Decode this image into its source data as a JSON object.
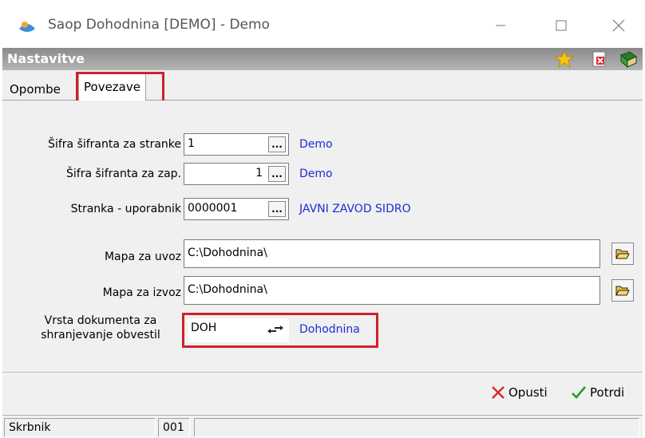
{
  "window": {
    "title": "Saop Dohodnina [DEMO] - Demo",
    "minimize_glyph": "—",
    "maximize_glyph": "☐",
    "close_glyph": "✕"
  },
  "section": {
    "title": "Nastavitve",
    "icons": [
      "star-icon",
      "close-document-icon",
      "exit-book-icon"
    ]
  },
  "tabs": [
    {
      "label": "Opombe",
      "active": false
    },
    {
      "label": "Povezave",
      "active": true
    }
  ],
  "form": {
    "sifra_stranke": {
      "label": "Šifra šifranta za stranke",
      "value": "1",
      "link": "Demo"
    },
    "sifra_zap": {
      "label": "Šifra šifranta za zap.",
      "value": "1",
      "link": "Demo"
    },
    "stranka": {
      "label": "Stranka - uporabnik",
      "value": "0000001",
      "link": "JAVNI ZAVOD SIDRO"
    },
    "mapa_uvoz": {
      "label": "Mapa za uvoz",
      "value": "C:\\Dohodnina\\"
    },
    "mapa_izvoz": {
      "label": "Mapa za izvoz",
      "value": "C:\\Dohodnina\\"
    },
    "vrsta_dok": {
      "label_line1": "Vrsta dokumenta za",
      "label_line2": "shranjevanje obvestil",
      "value": "DOH",
      "link": "Dohodnina"
    },
    "dots_glyph": "..."
  },
  "footer": {
    "cancel_label": "Opusti",
    "confirm_label": "Potrdi"
  },
  "status": {
    "user": "Skrbnik",
    "code": "001",
    "extra": ""
  },
  "colors": {
    "highlight": "#d0202c",
    "link": "#1c2bd6",
    "section_bar": "#9a9a9a"
  }
}
